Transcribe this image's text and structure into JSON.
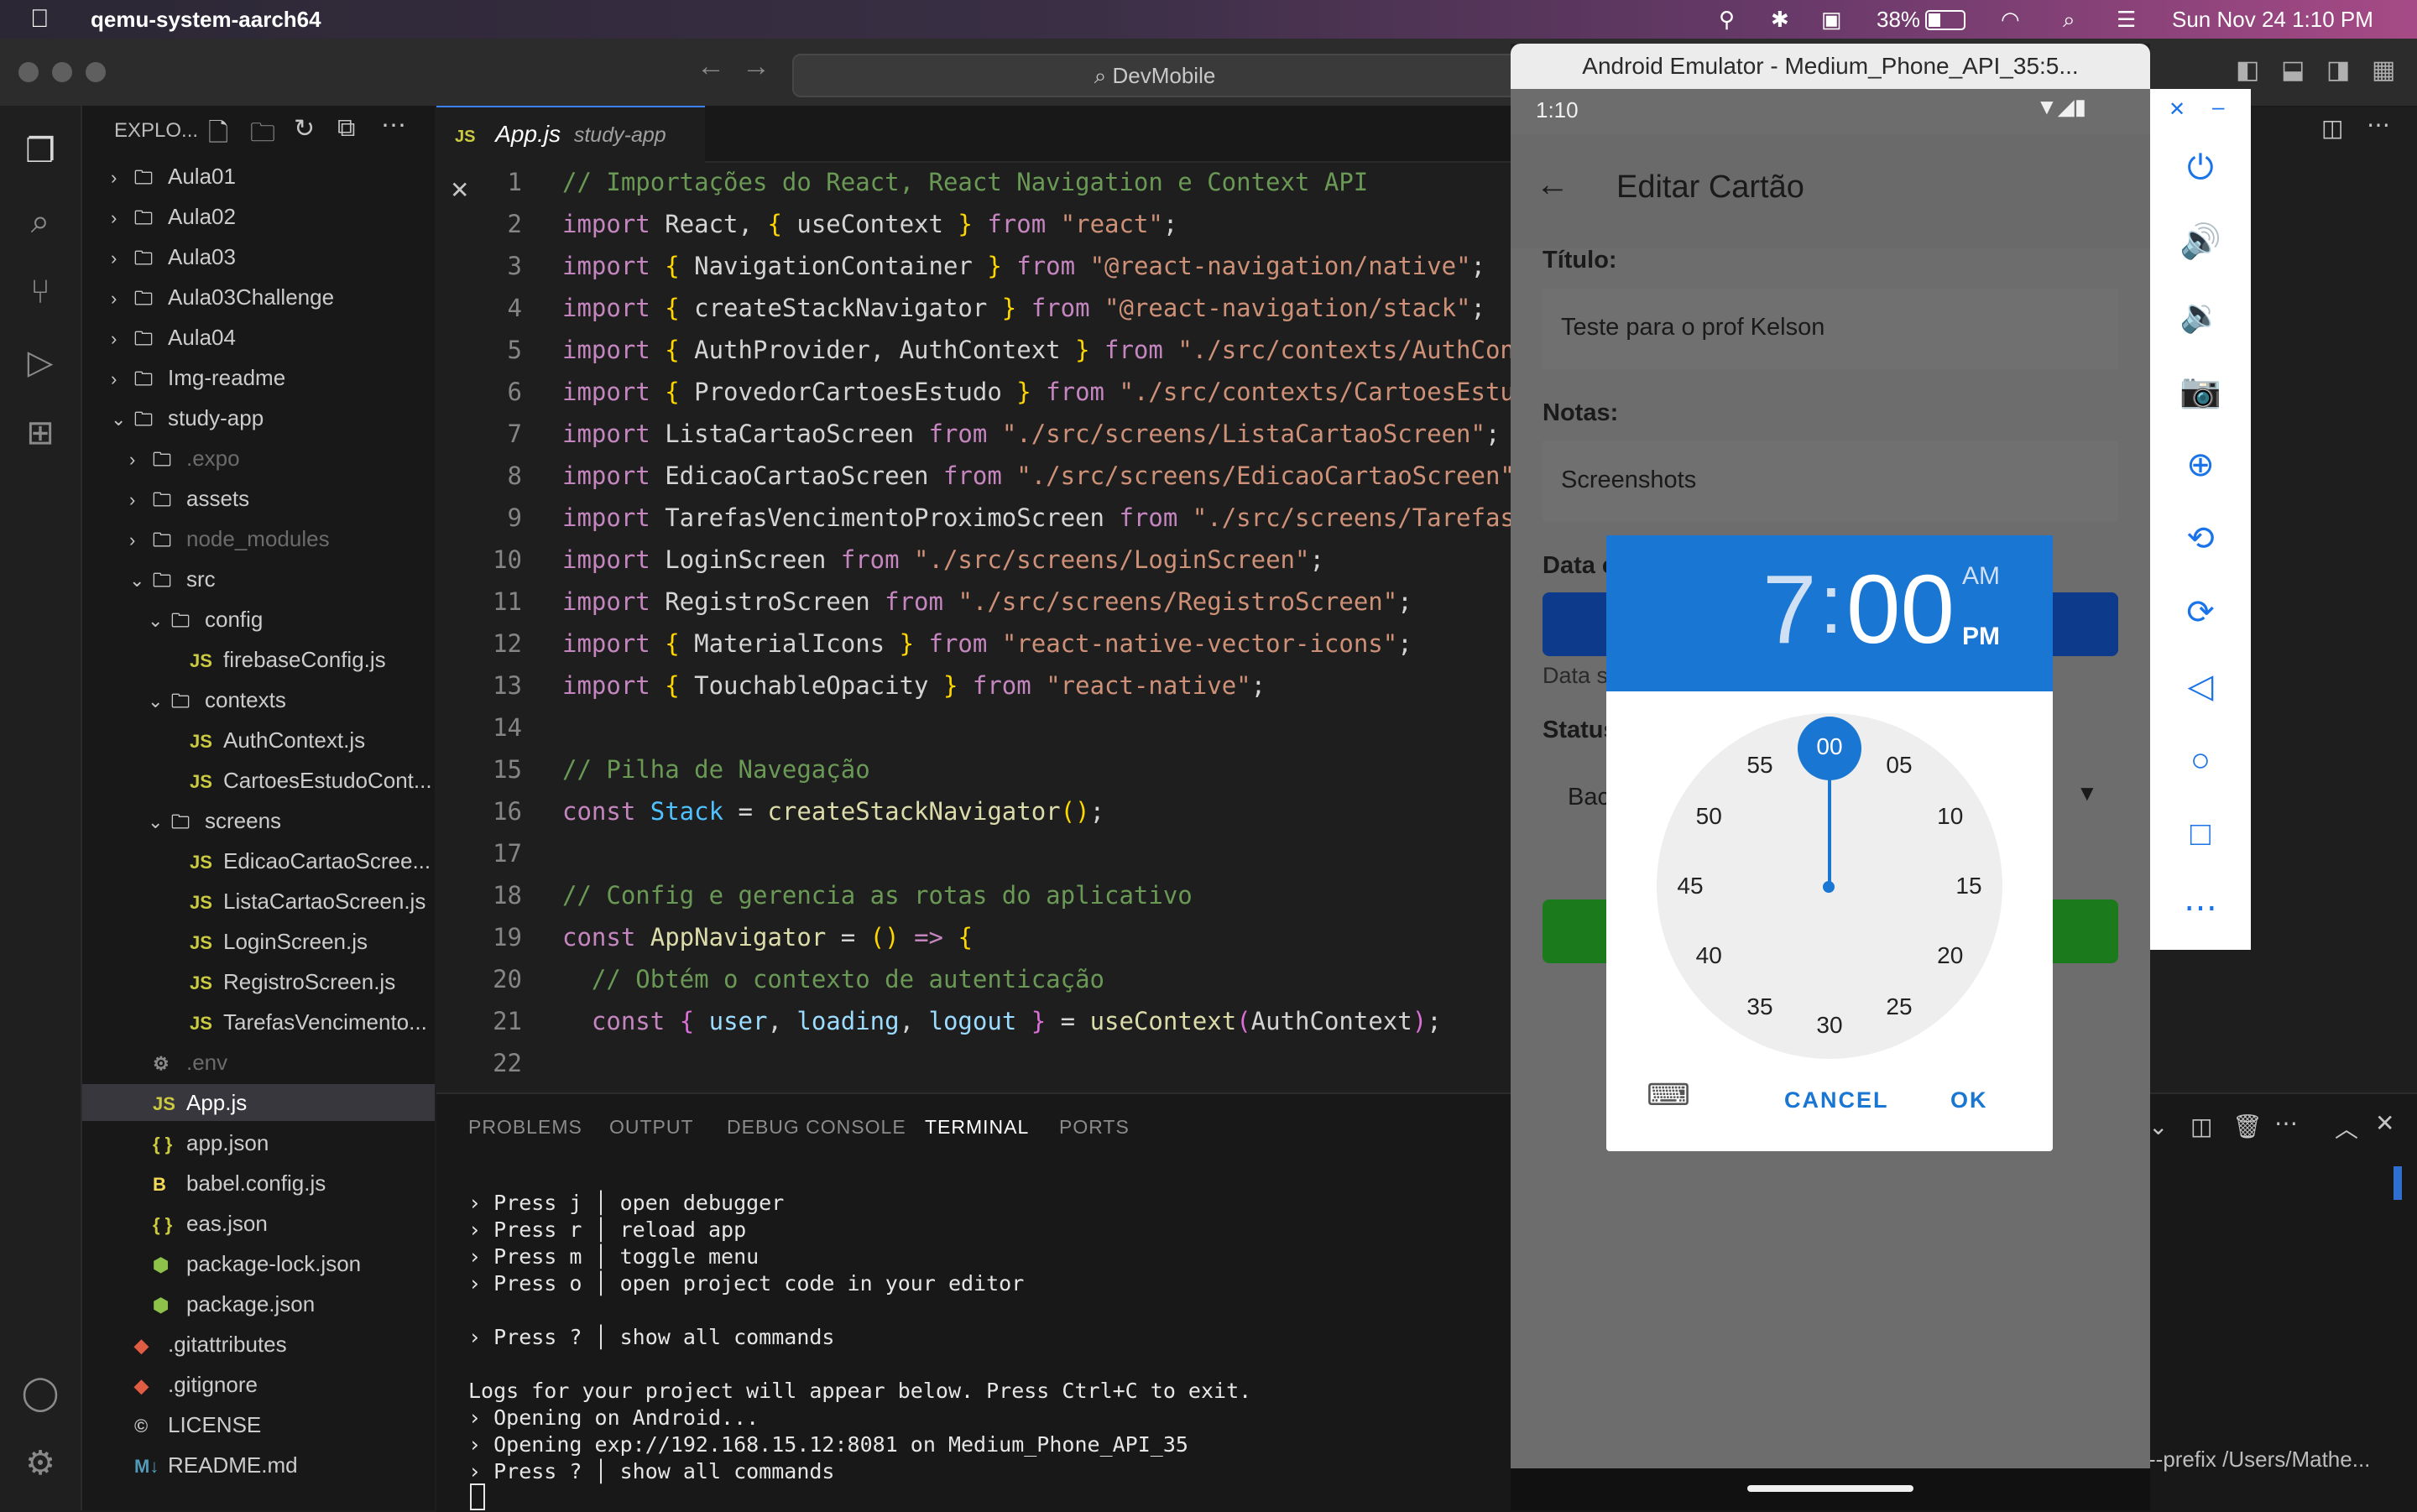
{
  "menubar": {
    "app_name": "qemu-system-aarch64",
    "battery": "38%",
    "datetime": "Sun Nov 24  1:10 PM"
  },
  "vscode": {
    "command_center": "DevMobile",
    "explorer_title": "EXPLO...",
    "tab": {
      "name": "App.js",
      "folder": "study-app"
    },
    "tree": [
      {
        "label": "Aula01",
        "indent": 0,
        "type": "folder",
        "expanded": false
      },
      {
        "label": "Aula02",
        "indent": 0,
        "type": "folder",
        "expanded": false
      },
      {
        "label": "Aula03",
        "indent": 0,
        "type": "folder",
        "expanded": false
      },
      {
        "label": "Aula03Challenge",
        "indent": 0,
        "type": "folder",
        "expanded": false
      },
      {
        "label": "Aula04",
        "indent": 0,
        "type": "folder",
        "expanded": false
      },
      {
        "label": "Img-readme",
        "indent": 0,
        "type": "folder",
        "expanded": false
      },
      {
        "label": "study-app",
        "indent": 0,
        "type": "folder",
        "expanded": true
      },
      {
        "label": ".expo",
        "indent": 1,
        "type": "folder",
        "expanded": false,
        "dim": true
      },
      {
        "label": "assets",
        "indent": 1,
        "type": "folder",
        "expanded": false
      },
      {
        "label": "node_modules",
        "indent": 1,
        "type": "folder",
        "expanded": false,
        "dim": true
      },
      {
        "label": "src",
        "indent": 1,
        "type": "folder",
        "expanded": true
      },
      {
        "label": "config",
        "indent": 2,
        "type": "folder",
        "expanded": true
      },
      {
        "label": "firebaseConfig.js",
        "indent": 3,
        "type": "js"
      },
      {
        "label": "contexts",
        "indent": 2,
        "type": "folder",
        "expanded": true
      },
      {
        "label": "AuthContext.js",
        "indent": 3,
        "type": "js"
      },
      {
        "label": "CartoesEstudoCont...",
        "indent": 3,
        "type": "js"
      },
      {
        "label": "screens",
        "indent": 2,
        "type": "folder",
        "expanded": true
      },
      {
        "label": "EdicaoCartaoScree...",
        "indent": 3,
        "type": "js"
      },
      {
        "label": "ListaCartaoScreen.js",
        "indent": 3,
        "type": "js"
      },
      {
        "label": "LoginScreen.js",
        "indent": 3,
        "type": "js"
      },
      {
        "label": "RegistroScreen.js",
        "indent": 3,
        "type": "js"
      },
      {
        "label": "TarefasVencimento...",
        "indent": 3,
        "type": "js"
      },
      {
        "label": ".env",
        "indent": 1,
        "type": "env",
        "dim": true
      },
      {
        "label": "App.js",
        "indent": 1,
        "type": "js",
        "selected": true
      },
      {
        "label": "app.json",
        "indent": 1,
        "type": "json"
      },
      {
        "label": "babel.config.js",
        "indent": 1,
        "type": "babel"
      },
      {
        "label": "eas.json",
        "indent": 1,
        "type": "json"
      },
      {
        "label": "package-lock.json",
        "indent": 1,
        "type": "npm"
      },
      {
        "label": "package.json",
        "indent": 1,
        "type": "npm"
      },
      {
        "label": ".gitattributes",
        "indent": 0,
        "type": "git"
      },
      {
        "label": ".gitignore",
        "indent": 0,
        "type": "git"
      },
      {
        "label": "LICENSE",
        "indent": 0,
        "type": "license"
      },
      {
        "label": "README.md",
        "indent": 0,
        "type": "md"
      }
    ],
    "code": [
      [
        [
          "cm",
          "// Importações do React, React Navigation e Context API"
        ]
      ],
      [
        [
          "kw",
          "import "
        ],
        [
          "op",
          "React, "
        ],
        [
          "br",
          "{ "
        ],
        [
          "op",
          "useContext "
        ],
        [
          "br",
          "} "
        ],
        [
          "kw",
          "from "
        ],
        [
          "str",
          "\"react\""
        ],
        [
          "op",
          ";"
        ]
      ],
      [
        [
          "kw",
          "import "
        ],
        [
          "br",
          "{ "
        ],
        [
          "op",
          "NavigationContainer "
        ],
        [
          "br",
          "} "
        ],
        [
          "kw",
          "from "
        ],
        [
          "str",
          "\"@react-navigation/native\""
        ],
        [
          "op",
          ";"
        ]
      ],
      [
        [
          "kw",
          "import "
        ],
        [
          "br",
          "{ "
        ],
        [
          "op",
          "createStackNavigator "
        ],
        [
          "br",
          "} "
        ],
        [
          "kw",
          "from "
        ],
        [
          "str",
          "\"@react-navigation/stack\""
        ],
        [
          "op",
          ";"
        ]
      ],
      [
        [
          "kw",
          "import "
        ],
        [
          "br",
          "{ "
        ],
        [
          "op",
          "AuthProvider, AuthContext "
        ],
        [
          "br",
          "} "
        ],
        [
          "kw",
          "from "
        ],
        [
          "str",
          "\"./src/contexts/AuthContex"
        ]
      ],
      [
        [
          "kw",
          "import "
        ],
        [
          "br",
          "{ "
        ],
        [
          "op",
          "ProvedorCartoesEstudo "
        ],
        [
          "br",
          "} "
        ],
        [
          "kw",
          "from "
        ],
        [
          "str",
          "\"./src/contexts/CartoesEstudoC"
        ]
      ],
      [
        [
          "kw",
          "import "
        ],
        [
          "op",
          "ListaCartaoScreen "
        ],
        [
          "kw",
          "from "
        ],
        [
          "str",
          "\"./src/screens/ListaCartaoScreen\""
        ],
        [
          "op",
          ";"
        ]
      ],
      [
        [
          "kw",
          "import "
        ],
        [
          "op",
          "EdicaoCartaoScreen "
        ],
        [
          "kw",
          "from "
        ],
        [
          "str",
          "\"./src/screens/EdicaoCartaoScreen\""
        ],
        [
          "op",
          ";"
        ]
      ],
      [
        [
          "kw",
          "import "
        ],
        [
          "op",
          "TarefasVencimentoProximoScreen "
        ],
        [
          "kw",
          "from "
        ],
        [
          "str",
          "\"./src/screens/TarefasVer"
        ]
      ],
      [
        [
          "kw",
          "import "
        ],
        [
          "op",
          "LoginScreen "
        ],
        [
          "kw",
          "from "
        ],
        [
          "str",
          "\"./src/screens/LoginScreen\""
        ],
        [
          "op",
          ";"
        ]
      ],
      [
        [
          "kw",
          "import "
        ],
        [
          "op",
          "RegistroScreen "
        ],
        [
          "kw",
          "from "
        ],
        [
          "str",
          "\"./src/screens/RegistroScreen\""
        ],
        [
          "op",
          ";"
        ]
      ],
      [
        [
          "kw",
          "import "
        ],
        [
          "br",
          "{ "
        ],
        [
          "op",
          "MaterialIcons "
        ],
        [
          "br",
          "} "
        ],
        [
          "kw",
          "from "
        ],
        [
          "str",
          "\"react-native-vector-icons\""
        ],
        [
          "op",
          ";"
        ]
      ],
      [
        [
          "kw",
          "import "
        ],
        [
          "br",
          "{ "
        ],
        [
          "op",
          "TouchableOpacity "
        ],
        [
          "br",
          "} "
        ],
        [
          "kw",
          "from "
        ],
        [
          "str",
          "\"react-native\""
        ],
        [
          "op",
          ";"
        ]
      ],
      [],
      [
        [
          "cm",
          "// Pilha de Navegação"
        ]
      ],
      [
        [
          "kw",
          "const "
        ],
        [
          "cls",
          "Stack "
        ],
        [
          "op",
          "= "
        ],
        [
          "fn",
          "createStackNavigator"
        ],
        [
          "br",
          "()"
        ],
        [
          "op",
          ";"
        ]
      ],
      [],
      [
        [
          "cm",
          "// Config e gerencia as rotas do aplicativo"
        ]
      ],
      [
        [
          "kw",
          "const "
        ],
        [
          "fn",
          "AppNavigator "
        ],
        [
          "op",
          "= "
        ],
        [
          "br",
          "() "
        ],
        [
          "kw",
          "=> "
        ],
        [
          "br",
          "{"
        ]
      ],
      [
        [
          "op",
          "  "
        ],
        [
          "cm",
          "// Obtém o contexto de autenticação"
        ]
      ],
      [
        [
          "op",
          "  "
        ],
        [
          "kw",
          "const "
        ],
        [
          "br2",
          "{ "
        ],
        [
          "var",
          "user"
        ],
        [
          "op",
          ", "
        ],
        [
          "var",
          "loading"
        ],
        [
          "op",
          ", "
        ],
        [
          "var",
          "logout "
        ],
        [
          "br2",
          "} "
        ],
        [
          "op",
          "= "
        ],
        [
          "fn",
          "useContext"
        ],
        [
          "br2",
          "("
        ],
        [
          "op",
          "AuthContext"
        ],
        [
          "br2",
          ")"
        ],
        [
          "op",
          ";"
        ]
      ],
      []
    ],
    "panel_tabs": [
      "PROBLEMS",
      "OUTPUT",
      "DEBUG CONSOLE",
      "TERMINAL",
      "PORTS"
    ],
    "active_panel_tab": "TERMINAL",
    "terminal": [
      "› Press j │ open debugger",
      "› Press r │ reload app",
      "› Press m │ toggle menu",
      "› Press o │ open project code in your editor",
      "",
      "› Press ? │ show all commands",
      "",
      "Logs for your project will appear below. Press Ctrl+C to exit.",
      "› Opening on Android...",
      "› Opening exp://192.168.15.12:8081 on Medium_Phone_API_35",
      "› Press ? │ show all commands"
    ],
    "terminal_side_text": "--prefix /Users/Mathe..."
  },
  "emulator": {
    "window_title": "Android Emulator - Medium_Phone_API_35:5...",
    "status_time": "1:10",
    "screen_title": "Editar Cartão",
    "titulo_label": "Título:",
    "titulo_value": "Teste para o prof Kelson",
    "notas_label": "Notas:",
    "notas_value": "Screenshots",
    "data_label": "Data c",
    "data_hint": "Data s",
    "status_label": "Status",
    "status_value": "Bac",
    "dialog": {
      "hour": "7",
      "sep": ":",
      "minute": "00",
      "am": "AM",
      "pm": "PM",
      "selected_period": "PM",
      "minutes": [
        "00",
        "05",
        "10",
        "15",
        "20",
        "25",
        "30",
        "35",
        "40",
        "45",
        "50",
        "55"
      ],
      "selected_minute": "00",
      "cancel": "CANCEL",
      "ok": "OK"
    },
    "side_icons": [
      "power-icon",
      "volume-up-icon",
      "volume-down-icon",
      "camera-icon",
      "zoom-icon",
      "rotate-left-icon",
      "rotate-right-icon",
      "back-icon",
      "home-icon",
      "overview-icon",
      "more-icon"
    ]
  }
}
